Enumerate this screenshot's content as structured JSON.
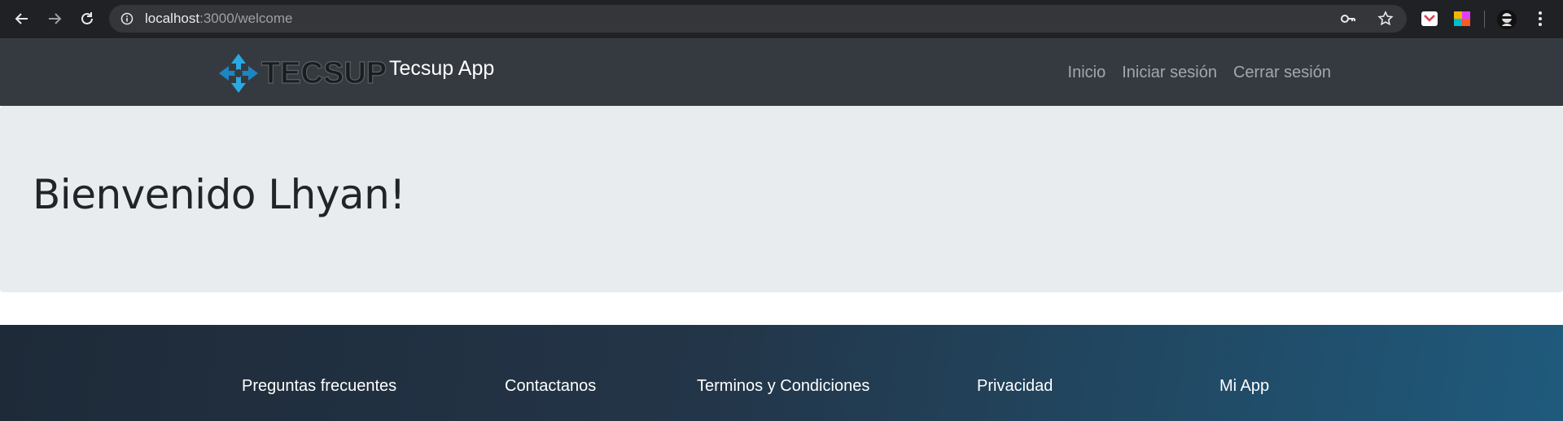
{
  "browser": {
    "url_host": "localhost",
    "url_path": ":3000/welcome"
  },
  "navbar": {
    "brand": "Tecsup App",
    "links": [
      "Inicio",
      "Iniciar sesión",
      "Cerrar sesión"
    ]
  },
  "jumbotron": {
    "heading": "Bienvenido Lhyan!"
  },
  "footer": {
    "links": [
      "Preguntas frecuentes",
      "Contactanos",
      "Terminos y Condiciones",
      "Privacidad",
      "Mi App"
    ]
  },
  "colors": {
    "navbar_bg": "#343a40",
    "jumbotron_bg": "#e9ecef",
    "footer_gradient_start": "#1e2a38",
    "footer_gradient_end": "#1f5a7c",
    "logo_blue": "#29a9e1"
  }
}
